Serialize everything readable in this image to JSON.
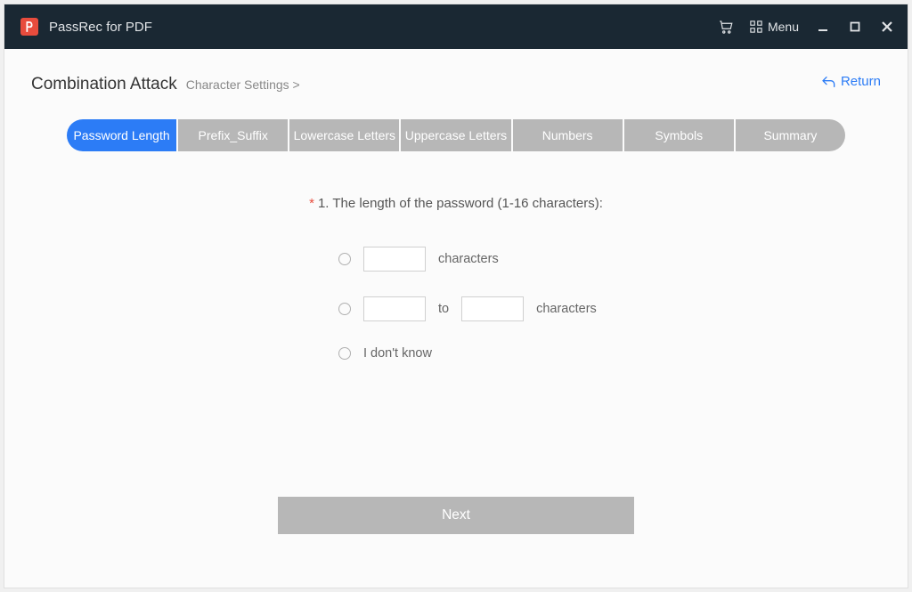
{
  "titlebar": {
    "app_title": "PassRec for PDF",
    "menu_label": "Menu"
  },
  "header": {
    "title": "Combination Attack",
    "breadcrumb": "Character Settings >",
    "return_label": "Return"
  },
  "tabs": [
    {
      "label": "Password Length",
      "active": true
    },
    {
      "label": "Prefix_Suffix",
      "active": false
    },
    {
      "label": "Lowercase Letters",
      "active": false
    },
    {
      "label": "Uppercase Letters",
      "active": false
    },
    {
      "label": "Numbers",
      "active": false
    },
    {
      "label": "Symbols",
      "active": false
    },
    {
      "label": "Summary",
      "active": false
    }
  ],
  "form": {
    "required_mark": "*",
    "question": "1. The length of the password (1-16 characters):",
    "option1_suffix": "characters",
    "option2_mid": "to",
    "option2_suffix": "characters",
    "option3_label": "I don't know",
    "next_label": "Next"
  }
}
